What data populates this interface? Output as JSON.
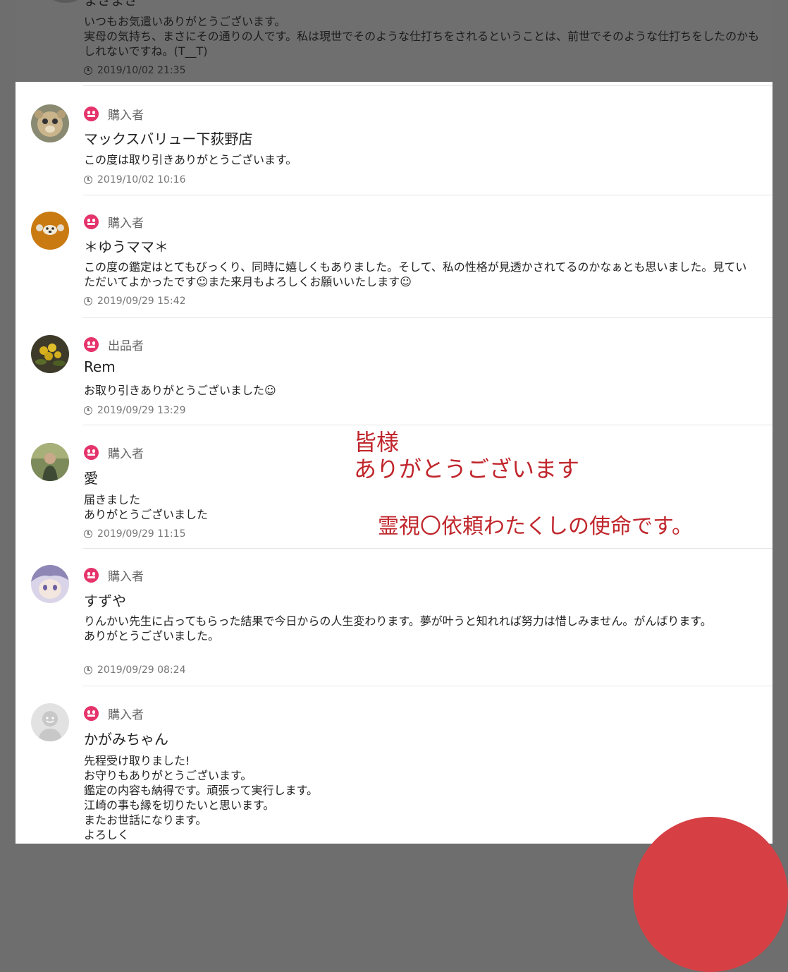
{
  "top_review": {
    "name": "まさまさ",
    "comment": "いつもお気遣いありがとうございます。\n実母の気持ち、まさにその通りの人です。私は現世でそのような仕打ちをされるということは、前世でそのような仕打ちをしたのかもしれないですね。(T__T)",
    "date": "2019/10/02 21:35"
  },
  "reviews": [
    {
      "role": "購入者",
      "user": "マックスバリュー下荻野店",
      "comment": "この度は取り引きありがとうございます。",
      "date": "2019/10/02 10:16",
      "avatar": "avatar-monkey"
    },
    {
      "role": "購入者",
      "user": "＊ゆうママ＊",
      "comment": "この度の鑑定はとてもびっくり、同時に嬉しくもありました。そして、私の性格が見透かされてるのかなぁとも思いました。見ていただいてよかったです☺また来月もよろしくお願いいたします☺",
      "date": "2019/09/29 15:42",
      "avatar": "avatar-bear"
    },
    {
      "role": "出品者",
      "user": "Rem",
      "comment": "お取り引きありがとうございました☺",
      "date": "2019/09/29 13:29",
      "avatar": "avatar-fruit"
    },
    {
      "role": "購入者",
      "user": "愛",
      "comment": "届きました\nありがとうございました",
      "date": "2019/09/29 11:15",
      "avatar": "avatar-person"
    },
    {
      "role": "購入者",
      "user": "すずや",
      "comment": "りんかい先生に占ってもらった結果で今日からの人生変わります。夢が叶うと知れれば努力は惜しみません。がんばります。\nありがとうございました。",
      "date": "2019/09/29 08:24",
      "avatar": "avatar-anime"
    },
    {
      "role": "購入者",
      "user": "かがみちゃん",
      "comment": "先程受け取りました!\nお守りもありがとうございます。\n鑑定の内容も納得です。頑張って実行します。\n江崎の事も縁を切りたいと思います。\nまたお世話になります。\nよろしく",
      "date": "",
      "avatar": "avatar-default"
    }
  ],
  "annotation": {
    "line1": "皆様",
    "line2": "ありがとうございます",
    "line3": "霊視〇依頼わたくしの使命です。"
  },
  "colors": {
    "role_icon": "#e5336b",
    "annotation": "#c0262c",
    "fab": "#d64045"
  }
}
